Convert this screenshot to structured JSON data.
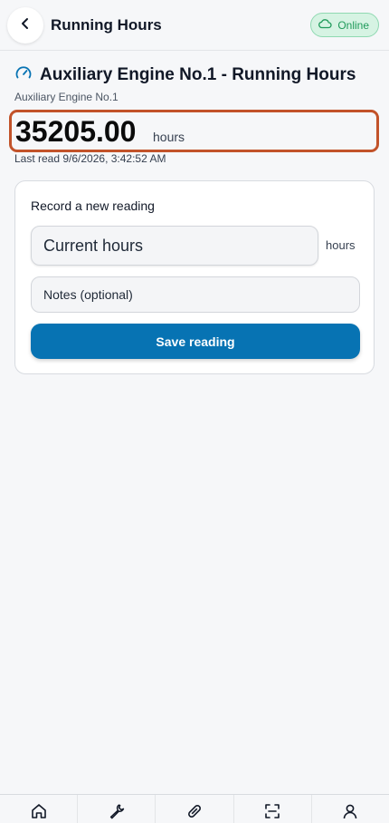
{
  "header": {
    "title": "Running Hours",
    "status_label": "Online",
    "back_icon": "chevron-left-icon",
    "status_icon": "cloud-icon"
  },
  "meter": {
    "title": "Auxiliary Engine No.1 - Running Hours",
    "subtitle": "Auxiliary Engine No.1",
    "reading": "35205.00",
    "unit": "hours",
    "last_read": "Last read 9/6/2026, 3:42:52 AM",
    "icon": "gauge-icon"
  },
  "form": {
    "title": "Record a new reading",
    "hours_placeholder": "Current hours",
    "hours_value": "",
    "hours_suffix": "hours",
    "notes_placeholder": "Notes (optional)",
    "notes_value": "",
    "save_label": "Save reading"
  },
  "nav": {
    "items": [
      {
        "icon": "home-icon"
      },
      {
        "icon": "wrench-icon"
      },
      {
        "icon": "pill-icon"
      },
      {
        "icon": "scan-icon"
      },
      {
        "icon": "user-icon"
      }
    ]
  },
  "colors": {
    "accent": "#0773b3",
    "highlight_border": "#c2532a",
    "online_bg": "#d6f3e3",
    "online_text": "#1f9a5a"
  }
}
